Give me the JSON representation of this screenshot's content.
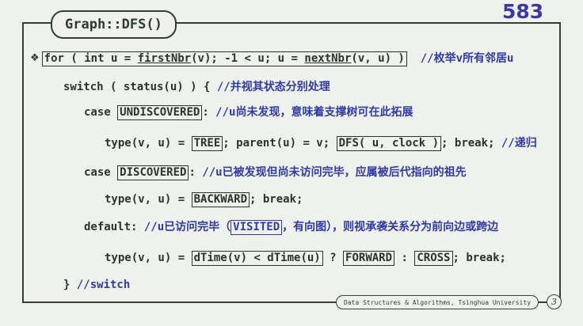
{
  "title": "Graph::DFS()",
  "page_number": "583",
  "bullet": "❖",
  "lines": {
    "for": {
      "kw": "for ( int u = ",
      "fn1": "firstNbr",
      "mid": "(v); -1 < u; u = ",
      "fn2": "nextNbr",
      "end": "(v, u) )",
      "comment": "//枚举v所有邻居u"
    },
    "switch": {
      "code": "switch ( status(u) ) { ",
      "comment": "//并视其状态分别处理"
    },
    "case_undiscovered": {
      "kw": "case ",
      "label": "UNDISCOVERED",
      "colon": ": ",
      "comment": "//u尚未发现，意味着支撑树可在此拓展"
    },
    "tree_line": {
      "pre": "type(v, u) = ",
      "box1": "TREE",
      "mid": "; parent(u) = v; ",
      "box2": "DFS( u, clock )",
      "post": "; break; ",
      "comment": "//递归"
    },
    "case_discovered": {
      "kw": "case ",
      "label": "DISCOVERED",
      "colon": ": ",
      "comment": "//u已被发现但尚未访问完毕，应属被后代指向的祖先"
    },
    "backward_line": {
      "pre": "type(v, u) = ",
      "box": "BACKWARD",
      "post": "; break;"
    },
    "default_line": {
      "kw": "default: ",
      "comment_pre": "//u已访问完毕（",
      "box": "VISITED",
      "comment_post": "，有向图），则视承袭关系分为前向边或跨边"
    },
    "forward_line": {
      "pre": "type(v, u) = ",
      "box1": "dTime(v) < dTime(u)",
      "mid1": " ? ",
      "box2": "FORWARD",
      "mid2": " : ",
      "box3": "CROSS",
      "post": "; break;"
    },
    "close": {
      "code": "} ",
      "comment": "//switch"
    }
  },
  "footer": {
    "text": "Data Structures & Algorithms, Tsinghua University",
    "badge": "3"
  }
}
